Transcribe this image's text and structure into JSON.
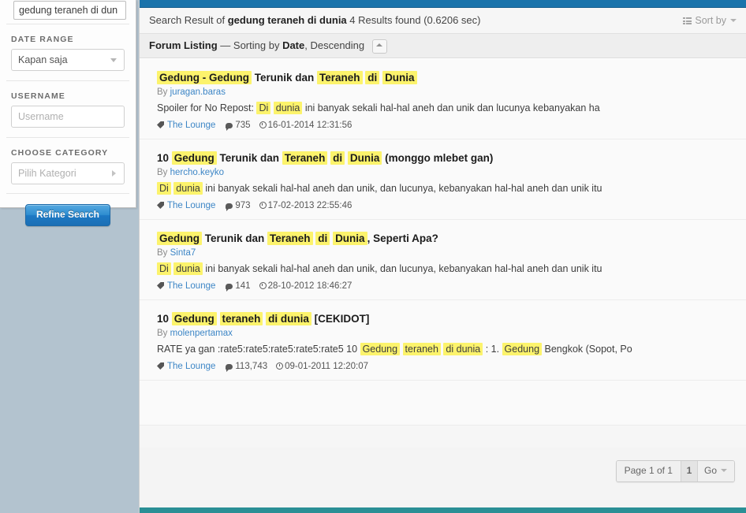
{
  "sidebar": {
    "search_value": "gedung teraneh di dun",
    "date_range": {
      "label": "DATE RANGE",
      "value": "Kapan saja"
    },
    "username": {
      "label": "USERNAME",
      "placeholder": "Username"
    },
    "category": {
      "label": "CHOOSE CATEGORY",
      "placeholder": "Pilih Kategori"
    },
    "refine_button": "Refine Search"
  },
  "header": {
    "prefix": "Search Result of ",
    "query": "gedung teraneh di dunia",
    "suffix": " 4 Results found (0.6206 sec)",
    "sort_by": "Sort by"
  },
  "listing": {
    "title": "Forum Listing",
    "dash": " — ",
    "sorting_prefix": "Sorting by ",
    "sort_field": "Date",
    "sort_dir": ", Descending"
  },
  "results": [
    {
      "title_parts": [
        {
          "t": "Gedung - Gedung",
          "hl": true
        },
        {
          "t": " Terunik dan ",
          "hl": false
        },
        {
          "t": "Teraneh",
          "hl": true
        },
        {
          "t": " ",
          "hl": false
        },
        {
          "t": "di",
          "hl": true
        },
        {
          "t": " ",
          "hl": false
        },
        {
          "t": "Dunia",
          "hl": true
        }
      ],
      "by_prefix": "By ",
      "author": "juragan.baras",
      "snippet_parts": [
        {
          "t": "Spoiler for No Repost: ",
          "hl": false
        },
        {
          "t": "Di",
          "hl": true
        },
        {
          "t": " ",
          "hl": false
        },
        {
          "t": "dunia",
          "hl": true
        },
        {
          "t": " ini banyak sekali hal-hal aneh dan unik dan lucunya kebanyakan ha",
          "hl": false
        }
      ],
      "forum": "The Lounge",
      "comments": "735",
      "date": "16-01-2014 12:31:56"
    },
    {
      "title_parts": [
        {
          "t": "10 ",
          "hl": false
        },
        {
          "t": "Gedung",
          "hl": true
        },
        {
          "t": " Terunik dan ",
          "hl": false
        },
        {
          "t": "Teraneh",
          "hl": true
        },
        {
          "t": " ",
          "hl": false
        },
        {
          "t": "di",
          "hl": true
        },
        {
          "t": " ",
          "hl": false
        },
        {
          "t": "Dunia",
          "hl": true
        },
        {
          "t": " (monggo mlebet gan)",
          "hl": false
        }
      ],
      "by_prefix": "By ",
      "author": "hercho.keyko",
      "snippet_parts": [
        {
          "t": "Di",
          "hl": true
        },
        {
          "t": " ",
          "hl": false
        },
        {
          "t": "dunia",
          "hl": true
        },
        {
          "t": " ini banyak sekali hal-hal aneh dan unik, dan lucunya, kebanyakan hal-hal aneh dan unik itu",
          "hl": false
        }
      ],
      "forum": "The Lounge",
      "comments": "973",
      "date": "17-02-2013 22:55:46"
    },
    {
      "title_parts": [
        {
          "t": "Gedung",
          "hl": true
        },
        {
          "t": " Terunik dan ",
          "hl": false
        },
        {
          "t": "Teraneh",
          "hl": true
        },
        {
          "t": " ",
          "hl": false
        },
        {
          "t": "di",
          "hl": true
        },
        {
          "t": " ",
          "hl": false
        },
        {
          "t": "Dunia",
          "hl": true
        },
        {
          "t": ", Seperti Apa?",
          "hl": false
        }
      ],
      "by_prefix": "By ",
      "author": "Sinta7",
      "snippet_parts": [
        {
          "t": "Di",
          "hl": true
        },
        {
          "t": " ",
          "hl": false
        },
        {
          "t": "dunia",
          "hl": true
        },
        {
          "t": " ini banyak sekali hal-hal aneh dan unik, dan lucunya, kebanyakan hal-hal aneh dan unik itu",
          "hl": false
        }
      ],
      "forum": "The Lounge",
      "comments": "141",
      "date": "28-10-2012 18:46:27"
    },
    {
      "title_parts": [
        {
          "t": "10 ",
          "hl": false
        },
        {
          "t": "Gedung",
          "hl": true
        },
        {
          "t": " ",
          "hl": false
        },
        {
          "t": "teraneh",
          "hl": true
        },
        {
          "t": " ",
          "hl": false
        },
        {
          "t": "di dunia",
          "hl": true
        },
        {
          "t": " [CEKIDOT]",
          "hl": false
        }
      ],
      "by_prefix": "By ",
      "author": "molenpertamax",
      "snippet_parts": [
        {
          "t": "RATE ya gan :rate5:rate5:rate5:rate5:rate5 10 ",
          "hl": false
        },
        {
          "t": "Gedung",
          "hl": true
        },
        {
          "t": " ",
          "hl": false
        },
        {
          "t": "teraneh",
          "hl": true
        },
        {
          "t": " ",
          "hl": false
        },
        {
          "t": "di dunia",
          "hl": true
        },
        {
          "t": " : 1. ",
          "hl": false
        },
        {
          "t": "Gedung",
          "hl": true
        },
        {
          "t": " Bengkok (Sopot, Po",
          "hl": false
        }
      ],
      "forum": "The Lounge",
      "comments": "113,743",
      "date": "09-01-2011 12:20:07"
    }
  ],
  "pagination": {
    "page_label": "Page 1 of 1",
    "page_input": "1",
    "go_label": "Go"
  },
  "colors": {
    "accent_blue": "#1a73ab",
    "highlight": "#fcf36c",
    "link": "#3d86c6",
    "footer_teal": "#2a8f95"
  }
}
